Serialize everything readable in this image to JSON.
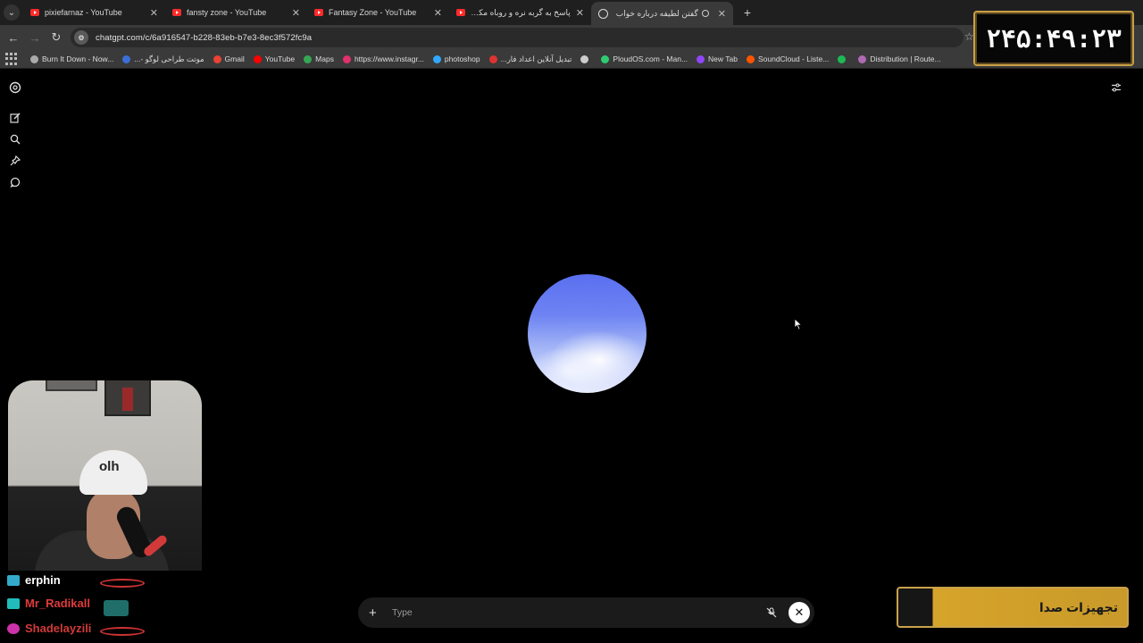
{
  "tabs": [
    {
      "title": "pixiefarnaz - YouTube",
      "kind": "youtube"
    },
    {
      "title": "fansty zone - YouTube",
      "kind": "youtube"
    },
    {
      "title": "Fantasy Zone - YouTube",
      "kind": "youtube"
    },
    {
      "title": "پاسخ به گربه نره و روباه مکار - be",
      "kind": "youtube"
    },
    {
      "title": "گفتن لطیفه درباره خواب",
      "kind": "chatgpt",
      "active": true
    }
  ],
  "address_bar": {
    "url": "chatgpt.com/c/6a916547-b228-83eb-b7e3-8ec3f572fc9a"
  },
  "bookmarks": [
    {
      "label": "Burn It Down - Now...",
      "color": "#aaaaaa"
    },
    {
      "label": "موتت طراحی لوگو -...",
      "color": "#3b6fd8"
    },
    {
      "label": "Gmail",
      "color": "#ea4335"
    },
    {
      "label": "YouTube",
      "color": "#ff0000"
    },
    {
      "label": "Maps",
      "color": "#34a853"
    },
    {
      "label": "https://www.instagr...",
      "color": "#e1306c"
    },
    {
      "label": "photoshop",
      "color": "#31a8ff"
    },
    {
      "label": "تبدیل آنلاین اعداد فار...",
      "color": "#d33"
    },
    {
      "label": "",
      "color": "#cccccc"
    },
    {
      "label": "PloudOS.com - Man...",
      "color": "#2ecc71"
    },
    {
      "label": "New Tab",
      "color": "#9146ff"
    },
    {
      "label": "SoundCloud - Liste...",
      "color": "#ff5500"
    },
    {
      "label": "",
      "color": "#1db954"
    },
    {
      "label": "Distribution | Route...",
      "color": "#b06ab3"
    }
  ],
  "timer": {
    "text": "۲۴۵:۴۹:۲۳"
  },
  "chatgpt": {
    "input_placeholder": "Type",
    "plus_glyph": "+",
    "mic_glyph": "🎙",
    "close_glyph": "✕"
  },
  "stream_chat": [
    {
      "user": "erphin",
      "color": "#ffffff",
      "badge": "#3ac"
    },
    {
      "user": "Mr_Radikall",
      "color": "#e03a3a",
      "badge": "#2bb"
    },
    {
      "user": "Shadelayzili",
      "color": "#d23a3a",
      "badge": "#c3a"
    }
  ],
  "webcam": {
    "cap_text": "olh"
  },
  "audio_banner": {
    "text": "تجهیزات صدا"
  },
  "colors": {
    "page_bg": "#000000",
    "chrome_bg": "#3a3a3a",
    "tabbar_bg": "#1f1f1f",
    "timer_border": "#c9a045",
    "banner_gold": "#d6a42a"
  },
  "icons": {
    "sidebar": [
      "openai-logo-icon",
      "new-chat-icon",
      "search-icon",
      "pin-icon",
      "chat-bubble-icon"
    ],
    "settings": "sliders-icon"
  }
}
